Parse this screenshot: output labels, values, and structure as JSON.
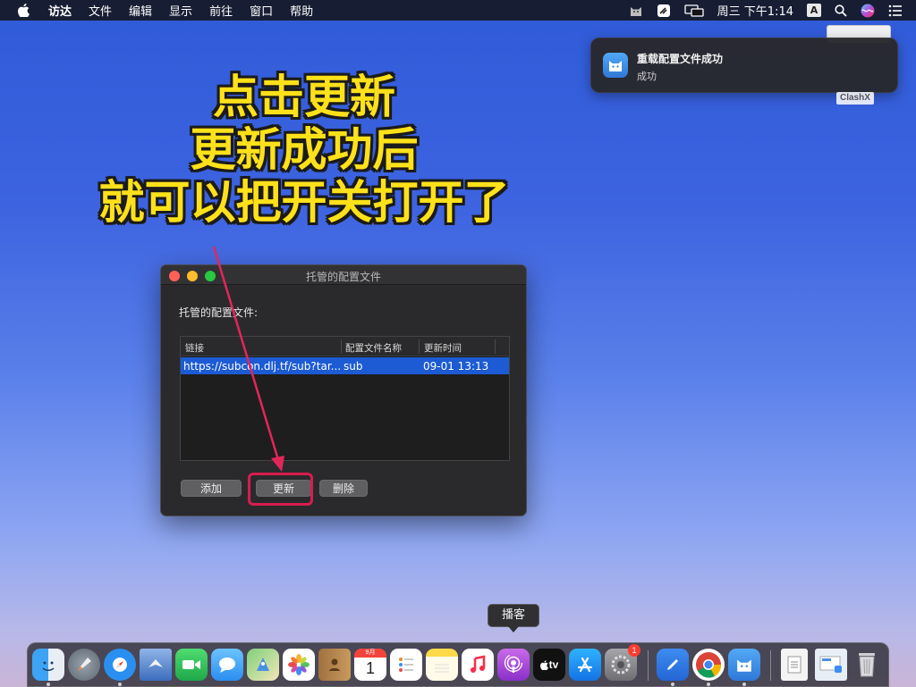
{
  "menubar": {
    "app_name": "访达",
    "items": [
      "文件",
      "编辑",
      "显示",
      "前往",
      "窗口",
      "帮助"
    ],
    "clock": "周三 下午1:14",
    "input_source": "A"
  },
  "notification": {
    "title": "重载配置文件成功",
    "body": "成功",
    "app_tag": "ClashX"
  },
  "caption": {
    "line1": "点击更新",
    "line2": "更新成功后",
    "line3": "就可以把开关打开了",
    "color": "#ffe11a"
  },
  "dialog": {
    "title": "托管的配置文件",
    "section_label": "托管的配置文件:",
    "columns": [
      "链接",
      "配置文件名称",
      "更新时间"
    ],
    "rows": [
      {
        "link": "https://subcon.dlj.tf/sub?tar...",
        "name": "sub",
        "updated": "09-01 13:13"
      }
    ],
    "buttons": {
      "add": "添加",
      "update": "更新",
      "delete": "删除"
    },
    "highlight_color": "#d81c4f",
    "selected_row_color": "#1c5bd4"
  },
  "dock": {
    "tooltip": "播客",
    "calendar_month": "9月",
    "calendar_day": "1",
    "appletv_label": "tv",
    "settings_badge": "1"
  }
}
